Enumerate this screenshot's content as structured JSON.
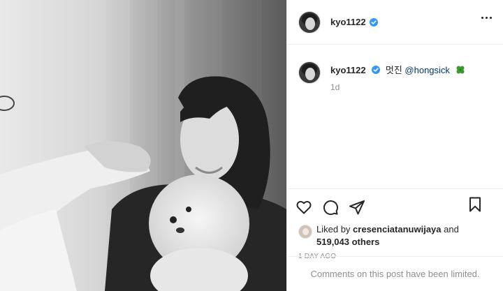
{
  "post": {
    "username": "kyo1122",
    "verified": true,
    "caption_text": "멋진",
    "caption_mention": "@hongsick",
    "caption_emoji": "four-leaf-clover",
    "caption_time": "1d",
    "liked_by_prefix": "Liked by ",
    "liked_by_user": "cresenciatanuwijaya",
    "liked_by_and": " and",
    "likes_count": "519,043 others",
    "time_ago": "1 DAY AGO",
    "comments_notice": "Comments on this post have been limited."
  },
  "icons": {
    "more": "more-options-icon",
    "verified": "verified-badge-icon",
    "like": "heart-icon",
    "comment": "comment-icon",
    "share": "paper-plane-icon",
    "save": "bookmark-icon"
  },
  "colors": {
    "verified_blue": "#3897f0",
    "mention_blue": "#00376b",
    "muted_gray": "#8e8e8e",
    "text": "#262626",
    "clover_green": "#3a9a2e"
  }
}
